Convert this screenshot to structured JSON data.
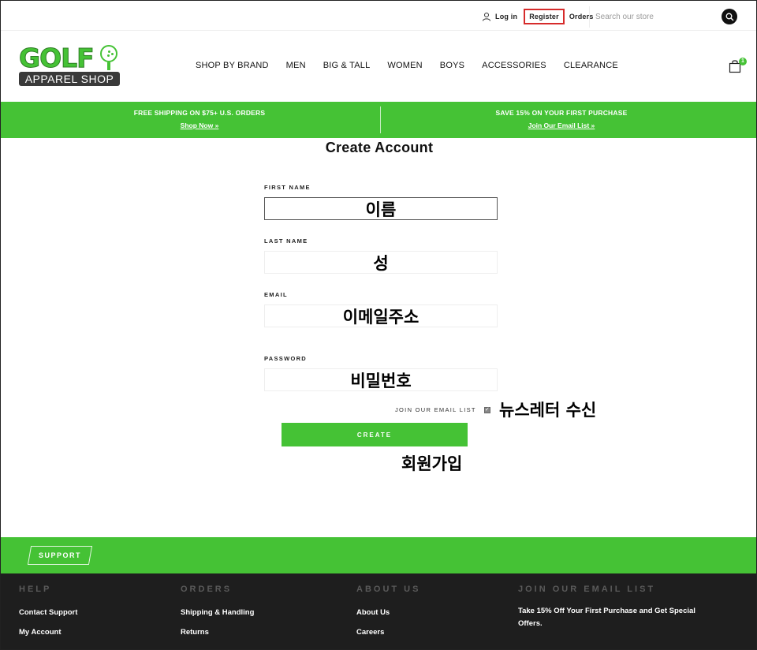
{
  "topbar": {
    "login_label": "Log in",
    "register_label": "Register",
    "orders_label": "Orders",
    "search_placeholder": "Search our store"
  },
  "header": {
    "logo_top": "GOLF",
    "logo_bottom": "APPAREL SHOP",
    "nav": [
      "SHOP BY BRAND",
      "MEN",
      "BIG & TALL",
      "WOMEN",
      "BOYS",
      "ACCESSORIES",
      "CLEARANCE"
    ],
    "cart_count": "1"
  },
  "promo": {
    "left_title": "FREE SHIPPING ON $75+ U.S. ORDERS",
    "left_link": "Shop Now »",
    "right_title": "SAVE 15% ON YOUR FIRST PURCHASE",
    "right_link": "Join Our Email List »"
  },
  "form": {
    "title": "Create Account",
    "first_name_label": "FIRST NAME",
    "first_name_overlay": "이름",
    "last_name_label": "LAST NAME",
    "last_name_overlay": "성",
    "email_label": "EMAIL",
    "email_overlay": "이메일주소",
    "password_label": "PASSWORD",
    "password_overlay": "비밀번호",
    "join_label": "JOIN OUR EMAIL LIST",
    "join_overlay": "뉴스레터 수신",
    "create_label": "CREATE",
    "create_overlay": "회원가입"
  },
  "support": {
    "label": "SUPPORT"
  },
  "footer": {
    "help_title": "HELP",
    "help_links": [
      "Contact Support",
      "My Account"
    ],
    "orders_title": "ORDERS",
    "orders_links": [
      "Shipping & Handling",
      "Returns"
    ],
    "about_title": "ABOUT US",
    "about_links": [
      "About Us",
      "Careers"
    ],
    "email_title": "JOIN OUR EMAIL LIST",
    "email_desc": "Take 15% Off Your First Purchase and Get Special Offers."
  },
  "colors": {
    "brand_green": "#45c235",
    "footer_bg": "#1e1e1e",
    "highlight_red": "#d62b2b"
  }
}
